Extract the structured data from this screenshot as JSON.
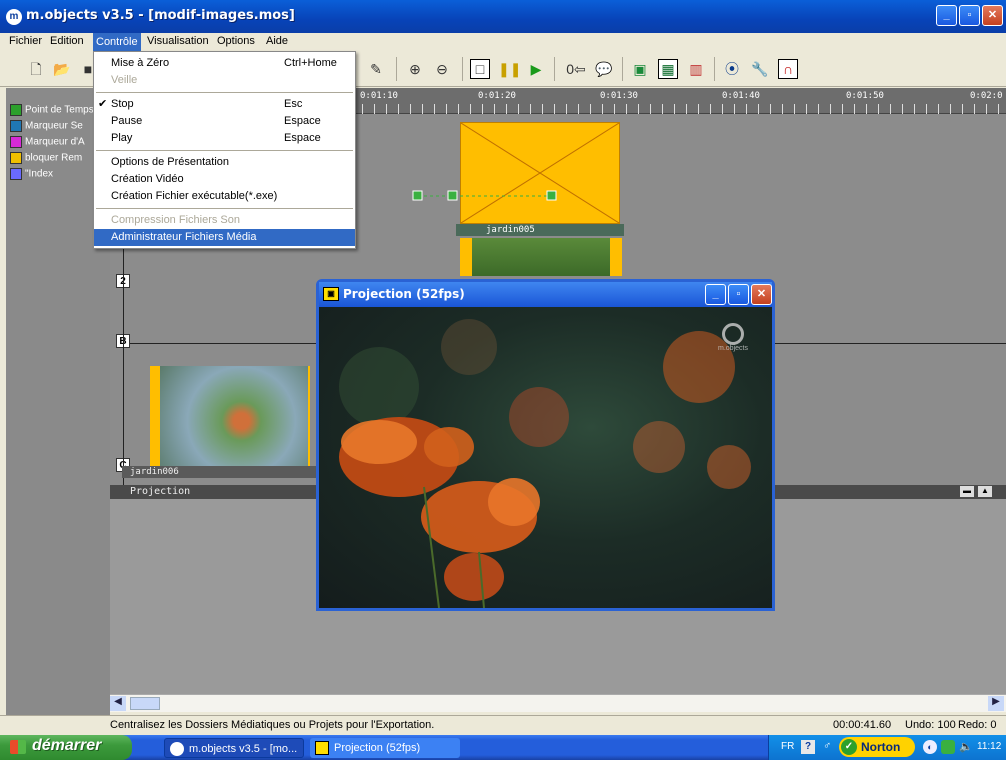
{
  "window": {
    "title": "m.objects v3.5 - [modif-images.mos]",
    "app_icon": "m-objects-icon"
  },
  "menubar": {
    "items": [
      "Fichier",
      "Edition",
      "Contrôle",
      "Visualisation",
      "Options",
      "Aide"
    ],
    "active": "Contrôle"
  },
  "dropdown": {
    "items": [
      {
        "label": "Mise à Zéro",
        "shortcut": "Ctrl+Home",
        "disabled": false
      },
      {
        "label": "Veille",
        "shortcut": "",
        "disabled": true
      },
      {
        "label": "Stop",
        "shortcut": "Esc",
        "checked": true
      },
      {
        "label": "Pause",
        "shortcut": "Espace"
      },
      {
        "label": "Play",
        "shortcut": "Espace"
      },
      {
        "label": "Options de Présentation",
        "shortcut": ""
      },
      {
        "label": "Création Vidéo",
        "shortcut": ""
      },
      {
        "label": "Création Fichier exécutable(*.exe)",
        "shortcut": ""
      },
      {
        "label": "Compression Fichiers Son",
        "shortcut": "",
        "disabled": true
      },
      {
        "label": "Administrateur Fichiers Média",
        "shortcut": "",
        "highlighted": true
      }
    ]
  },
  "markers": [
    {
      "label": "Point de Temps",
      "color": "#2ca02c"
    },
    {
      "label": "Marqueur Se",
      "color": "#1f77b4"
    },
    {
      "label": "Marqueur d'A",
      "color": "#d62ad6"
    },
    {
      "label": "bloquer Rem",
      "color": "#f0c000"
    },
    {
      "label": "\"Index",
      "color": "#6a6aff"
    }
  ],
  "ruler": {
    "labels": [
      "0:01:10",
      "0:01:20",
      "0:01:30",
      "0:01:40",
      "0:01:50",
      "0:02:0"
    ]
  },
  "tracks": {
    "numbers": [
      "2",
      "B",
      "C"
    ],
    "clip_top_label": "jardin005",
    "clip_bottom_label": "jardin006"
  },
  "projection_strip": {
    "label": "Projection"
  },
  "projection_window": {
    "title": "Projection (52fps)",
    "logo_text": "m.objects"
  },
  "statusbar": {
    "message": "Centralisez les Dossiers Médiatiques ou Projets pour l'Exportation.",
    "time": "00:00:41.60",
    "undo": "Undo: 100",
    "redo": "Redo: 0"
  },
  "taskbar": {
    "start_label": "démarrer",
    "tasks": [
      "m.objects v3.5 - [mo...",
      "Projection (52fps)"
    ],
    "tray": {
      "lang": "FR",
      "norton": "Norton",
      "clock": "11:12"
    }
  },
  "colors": {
    "xp_blue": "#0a5fd8",
    "menu_highlight": "#316ac5",
    "clip_yellow": "#ffbe00"
  }
}
